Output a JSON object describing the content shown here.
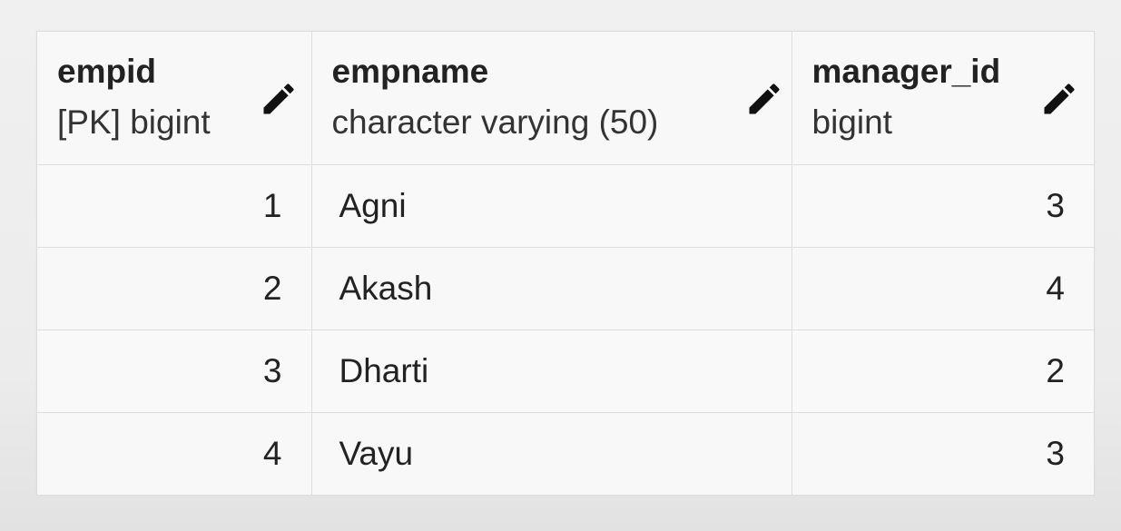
{
  "columns": [
    {
      "name": "empid",
      "type": "[PK] bigint",
      "icon": "pencil-icon"
    },
    {
      "name": "empname",
      "type": "character varying (50)",
      "icon": "pencil-icon"
    },
    {
      "name": "manager_id",
      "type": "bigint",
      "icon": "pencil-icon"
    }
  ],
  "rows": [
    {
      "empid": "1",
      "empname": "Agni",
      "manager_id": "3"
    },
    {
      "empid": "2",
      "empname": "Akash",
      "manager_id": "4"
    },
    {
      "empid": "3",
      "empname": "Dharti",
      "manager_id": "2"
    },
    {
      "empid": "4",
      "empname": "Vayu",
      "manager_id": "3"
    }
  ],
  "colors": {
    "header_bg": "#f8f8f8",
    "border": "#dedede",
    "text": "#222222",
    "icon": "#111111"
  }
}
